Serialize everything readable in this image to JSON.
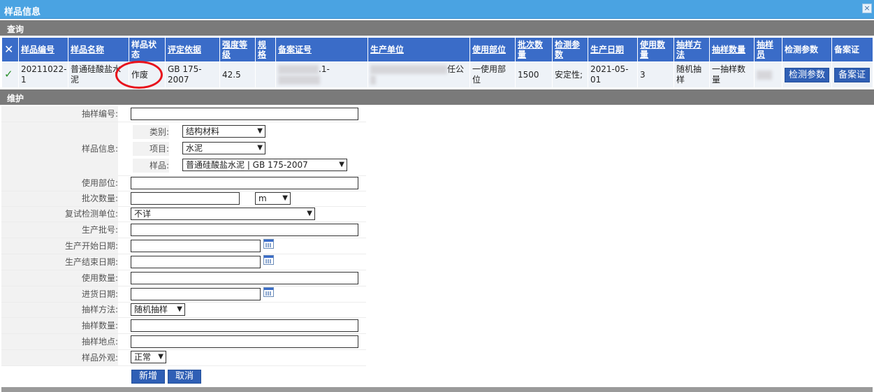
{
  "window": {
    "title": "样品信息",
    "close": "×"
  },
  "query_section": {
    "label": "查询"
  },
  "table": {
    "headers": [
      "样品编号",
      "样品名称",
      "样品状态",
      "评定依据",
      "强度等级",
      "规格",
      "备案证号",
      "生产单位",
      "使用部位",
      "批次数量",
      "检测参数",
      "生产日期",
      "使用数量",
      "抽样方法",
      "抽样数量",
      "抽样员",
      "检测参数",
      "备案证"
    ],
    "row": {
      "sample_no": "20211022-1",
      "sample_name": "普通硅酸盐水泥",
      "status": "作废",
      "basis": "GB 175-2007",
      "grade": "42.5",
      "spec": "",
      "record_no_suffix": ".1-",
      "producer_suffix": "任公",
      "use_part": "一使用部位",
      "batch_qty": "1500",
      "test_param": "安定性;",
      "prod_date": "2021-05-01",
      "use_qty": "3",
      "sampling_method": "随机抽样",
      "sampling_qty": "一抽样数量",
      "btn_params": "检测参数",
      "btn_cert": "备案证"
    }
  },
  "maintain_section": {
    "label": "维护"
  },
  "form": {
    "sample_no_label": "抽样编号:",
    "sample_info_label": "样品信息:",
    "category_label": "类别:",
    "category_value": "结构材料",
    "item_label": "项目:",
    "item_value": "水泥",
    "sample_label": "样品:",
    "sample_value": "普通硅酸盐水泥 | GB 175-2007",
    "use_part_label": "使用部位:",
    "batch_qty_label": "批次数量:",
    "unit_value": "m",
    "retest_label": "复试检测单位:",
    "retest_value": "不详",
    "prod_batch_label": "生产批号:",
    "prod_start_label": "生产开始日期:",
    "prod_end_label": "生产结束日期:",
    "use_qty_label": "使用数量:",
    "purchase_date_label": "进货日期:",
    "sampling_method_label": "抽样方法:",
    "sampling_method_value": "随机抽样",
    "sampling_qty_label": "抽样数量:",
    "sampling_place_label": "抽样地点:",
    "appearance_label": "样品外观:",
    "appearance_value": "正常",
    "add_button": "新增",
    "cancel_button": "取消"
  }
}
